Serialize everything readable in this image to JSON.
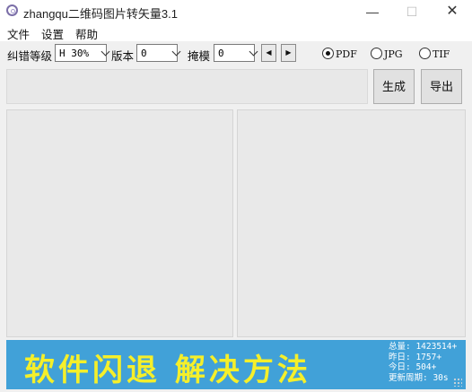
{
  "window": {
    "title": "zhangqu二维码图片转矢量3.1",
    "controls": {
      "minimize": "—",
      "maximize": "☐",
      "close": "✕"
    }
  },
  "menu": {
    "items": [
      "文件",
      "设置",
      "帮助"
    ]
  },
  "toolbar": {
    "ecc_label": "纠错等级",
    "ecc_value": "H 30%",
    "version_label": "版本",
    "version_value": "0",
    "mask_label": "掩模",
    "mask_value": "0",
    "prev_icon": "◀",
    "next_icon": "▶",
    "formats": [
      {
        "label": "PDF",
        "checked": true
      },
      {
        "label": "JPG",
        "checked": false
      },
      {
        "label": "TIF",
        "checked": false
      }
    ]
  },
  "actions": {
    "generate_label": "生成",
    "export_label": "导出"
  },
  "input": {
    "value": ""
  },
  "banner": {
    "text": "软件闪退 解决方法",
    "stats": [
      "总量: 1423514+",
      "昨日: 1757+",
      "今日: 504+",
      "更新周期: 30s"
    ],
    "bg_color": "#41a1d8",
    "text_color": "#f5ef2a"
  }
}
